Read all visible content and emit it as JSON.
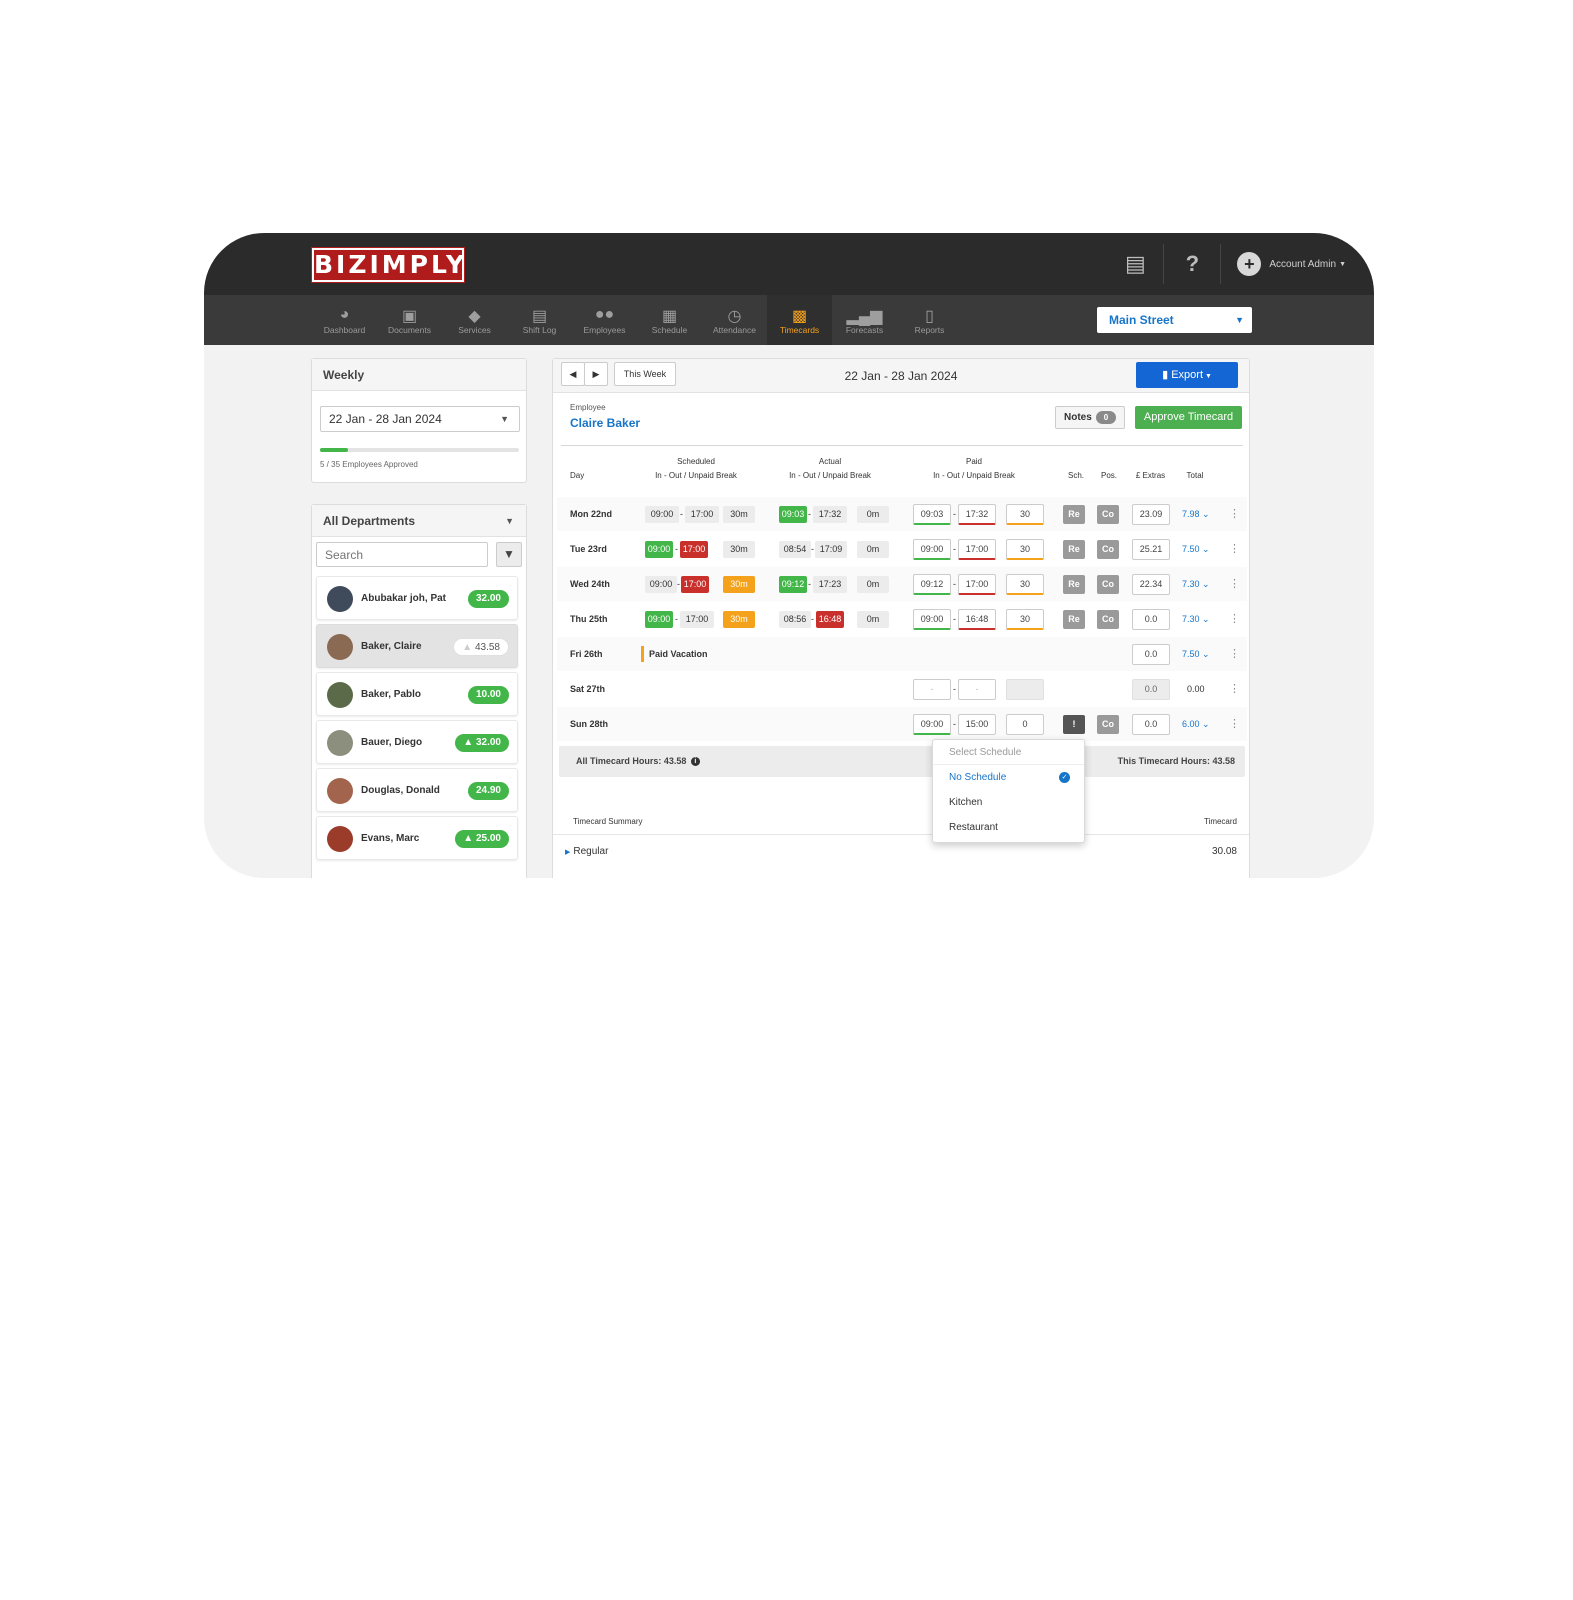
{
  "app": {
    "logo": "BIZIMPLY",
    "account": "Account Admin",
    "location": "Main Street"
  },
  "nav": [
    {
      "label": "Dashboard",
      "icon": "dashboard-icon"
    },
    {
      "label": "Documents",
      "icon": "folder-icon"
    },
    {
      "label": "Services",
      "icon": "tag-icon"
    },
    {
      "label": "Shift Log",
      "icon": "book-icon"
    },
    {
      "label": "Employees",
      "icon": "people-icon"
    },
    {
      "label": "Schedule",
      "icon": "calendar-icon"
    },
    {
      "label": "Attendance",
      "icon": "clock-icon"
    },
    {
      "label": "Timecards",
      "icon": "timecard-icon"
    },
    {
      "label": "Forecasts",
      "icon": "signal-icon"
    },
    {
      "label": "Reports",
      "icon": "report-icon"
    }
  ],
  "sidebar": {
    "period_title": "Weekly",
    "period_value": "22 Jan - 28 Jan 2024",
    "approved_text": "5 / 35 Employees Approved",
    "approved_fraction": 0.143,
    "department": "All Departments",
    "search_placeholder": "Search",
    "employees": [
      {
        "name": "Abubakar joh, Pat",
        "hours": "32.00"
      },
      {
        "name": "Baker, Claire",
        "hours": "43.58"
      },
      {
        "name": "Baker, Pablo",
        "hours": "10.00"
      },
      {
        "name": "Bauer, Diego",
        "hours": "32.00"
      },
      {
        "name": "Douglas, Donald",
        "hours": "24.90"
      },
      {
        "name": "Evans, Marc",
        "hours": "25.00"
      }
    ]
  },
  "main": {
    "this_week": "This Week",
    "date_range": "22 Jan - 28 Jan 2024",
    "export": "Export",
    "employee_label": "Employee",
    "employee_name": "Claire Baker",
    "notes": "Notes",
    "notes_count": "0",
    "approve": "Approve Timecard",
    "headers": {
      "day": "Day",
      "scheduled": "Scheduled",
      "actual": "Actual",
      "paid": "Paid",
      "sub": "In - Out / Unpaid Break",
      "sch": "Sch.",
      "pos": "Pos.",
      "extras": "£ Extras",
      "total": "Total"
    },
    "rows": [
      {
        "day": "Mon 22nd",
        "s_in": "09:00",
        "s_out": "17:00",
        "s_brk": "30m",
        "a_in": "09:03",
        "a_out": "17:32",
        "a_brk": "0m",
        "p_in": "09:03",
        "p_out": "17:32",
        "p_brk": "30",
        "sch": "Re",
        "pos": "Co",
        "extras": "23.09",
        "total": "7.98"
      },
      {
        "day": "Tue 23rd",
        "s_in": "09:00",
        "s_out": "17:00",
        "s_brk": "30m",
        "a_in": "08:54",
        "a_out": "17:09",
        "a_brk": "0m",
        "p_in": "09:00",
        "p_out": "17:00",
        "p_brk": "30",
        "sch": "Re",
        "pos": "Co",
        "extras": "25.21",
        "total": "7.50"
      },
      {
        "day": "Wed 24th",
        "s_in": "09:00",
        "s_out": "17:00",
        "s_brk": "30m",
        "a_in": "09:12",
        "a_out": "17:23",
        "a_brk": "0m",
        "p_in": "09:12",
        "p_out": "17:00",
        "p_brk": "30",
        "sch": "Re",
        "pos": "Co",
        "extras": "22.34",
        "total": "7.30"
      },
      {
        "day": "Thu 25th",
        "s_in": "09:00",
        "s_out": "17:00",
        "s_brk": "30m",
        "a_in": "08:56",
        "a_out": "16:48",
        "a_brk": "0m",
        "p_in": "09:00",
        "p_out": "16:48",
        "p_brk": "30",
        "sch": "Re",
        "pos": "Co",
        "extras": "0.0",
        "total": "7.30"
      },
      {
        "day": "Fri 26th",
        "vacation": "Paid Vacation",
        "extras": "0.0",
        "total": "7.50"
      },
      {
        "day": "Sat 27th",
        "p_in": "-",
        "p_out": "-",
        "extras": "0.0",
        "total": "0.00"
      },
      {
        "day": "Sun 28th",
        "p_in": "09:00",
        "p_out": "15:00",
        "p_brk": "0",
        "sch": "!",
        "pos": "Co",
        "extras": "0.0",
        "total": "6.00"
      }
    ],
    "all_hours": "All Timecard Hours: 43.58",
    "this_hours": "This Timecard Hours: 43.58",
    "summary_title": "Timecard Summary",
    "summary_col": "Timecard",
    "summary_label": "Regular",
    "summary_value": "30.08"
  },
  "popup": {
    "title": "Select Schedule",
    "options": [
      "No Schedule",
      "Kitchen",
      "Restaurant"
    ]
  },
  "colors": {
    "green": "#43b649",
    "red": "#c9302c",
    "orange": "#f4a11b",
    "blue": "#1775c9",
    "brand_red": "#b01c1c"
  }
}
